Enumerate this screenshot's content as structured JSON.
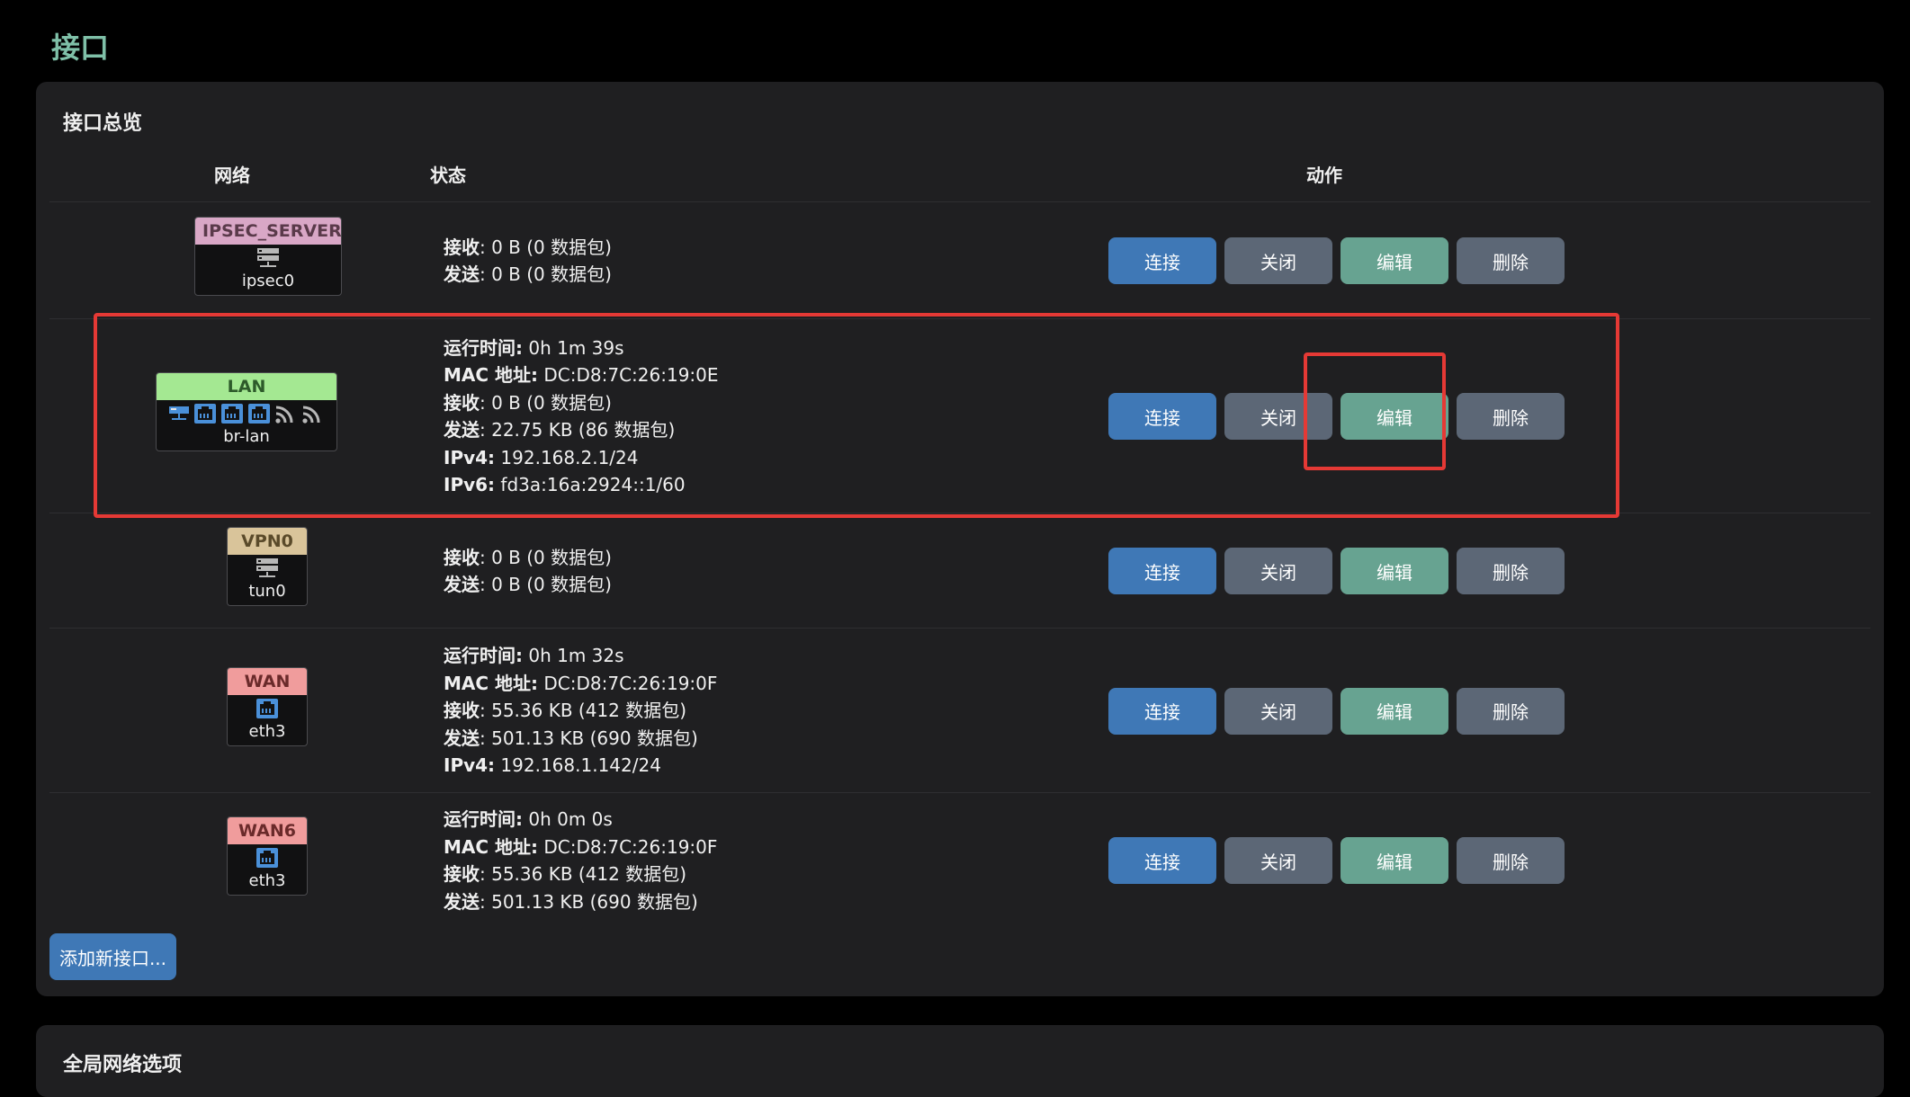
{
  "page_title": "接口",
  "overview": {
    "title": "接口总览",
    "columns": {
      "network": "网络",
      "status": "状态",
      "actions": "动作"
    },
    "actions": {
      "connect": "连接",
      "close": "关闭",
      "edit": "编辑",
      "delete": "删除"
    },
    "interfaces": [
      {
        "name": "IPSEC_SERVER",
        "device": "ipsec0",
        "tag_color": "#d9a7c6",
        "icons": [
          "server-icon"
        ],
        "status": [
          {
            "k": "接收",
            "v": ": 0 B (0 数据包)"
          },
          {
            "k": "发送",
            "v": ": 0 B (0 数据包)"
          }
        ]
      },
      {
        "name": "LAN",
        "device": "br-lan",
        "tag_color": "#a4e892",
        "icons": [
          "bridge-icon",
          "ethernet-port-icon",
          "ethernet-port-icon",
          "ethernet-port-icon",
          "wifi-icon",
          "wifi-icon"
        ],
        "status": [
          {
            "k": "运行时间:",
            "v": " 0h 1m 39s"
          },
          {
            "k": "MAC 地址:",
            "v": " DC:D8:7C:26:19:0E"
          },
          {
            "k": "接收",
            "v": ": 0 B (0 数据包)"
          },
          {
            "k": "发送",
            "v": ": 22.75 KB (86 数据包)"
          },
          {
            "k": "IPv4:",
            "v": " 192.168.2.1/24"
          },
          {
            "k": "IPv6:",
            "v": " fd3a:16a:2924::1/60"
          }
        ]
      },
      {
        "name": "VPN0",
        "device": "tun0",
        "tag_color": "#d9c49a",
        "icons": [
          "server-icon"
        ],
        "status": [
          {
            "k": "接收",
            "v": ": 0 B (0 数据包)"
          },
          {
            "k": "发送",
            "v": ": 0 B (0 数据包)"
          }
        ]
      },
      {
        "name": "WAN",
        "device": "eth3",
        "tag_color": "#f09c9c",
        "icons": [
          "ethernet-port-icon"
        ],
        "status": [
          {
            "k": "运行时间:",
            "v": " 0h 1m 32s"
          },
          {
            "k": "MAC 地址:",
            "v": " DC:D8:7C:26:19:0F"
          },
          {
            "k": "接收",
            "v": ": 55.36 KB (412 数据包)"
          },
          {
            "k": "发送",
            "v": ": 501.13 KB (690 数据包)"
          },
          {
            "k": "IPv4:",
            "v": " 192.168.1.142/24"
          }
        ]
      },
      {
        "name": "WAN6",
        "device": "eth3",
        "tag_color": "#f09c9c",
        "icons": [
          "ethernet-port-icon"
        ],
        "status": [
          {
            "k": "运行时间:",
            "v": " 0h 0m 0s"
          },
          {
            "k": "MAC 地址:",
            "v": " DC:D8:7C:26:19:0F"
          },
          {
            "k": "接收",
            "v": ": 55.36 KB (412 数据包)"
          },
          {
            "k": "发送",
            "v": ": 501.13 KB (690 数据包)"
          }
        ]
      }
    ],
    "add_button": "添加新接口..."
  },
  "global_options": {
    "title": "全局网络选项"
  },
  "colors": {
    "accent_title": "#7fc0a8",
    "connect": "#3f78b6",
    "edit": "#67a391",
    "neutral": "#5c6776",
    "highlight": "#e53935"
  }
}
